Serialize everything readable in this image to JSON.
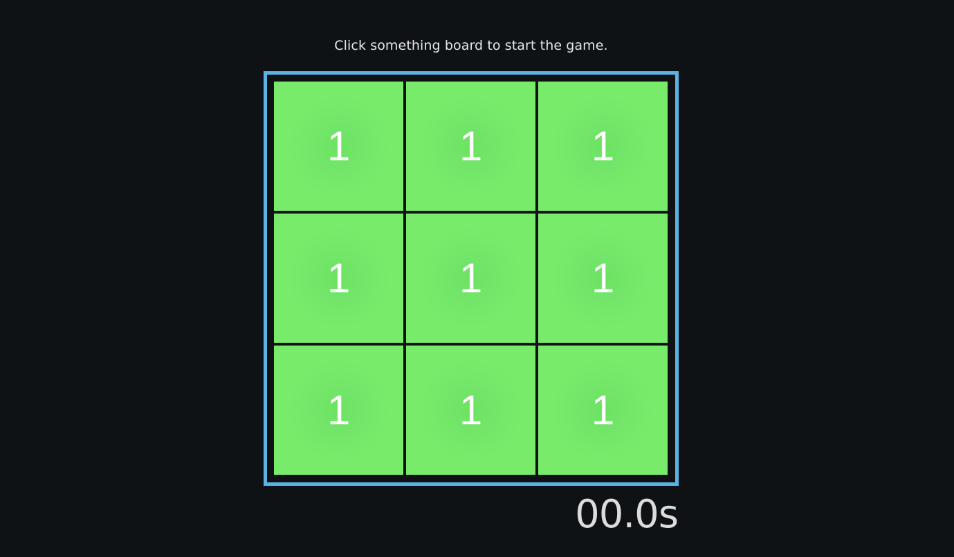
{
  "instruction": "Click something board to start the game.",
  "board": {
    "cells": [
      "1",
      "1",
      "1",
      "1",
      "1",
      "1",
      "1",
      "1",
      "1"
    ]
  },
  "timer": "00.0s",
  "colors": {
    "background": "#0f1215",
    "board_border": "#5cb3e3",
    "cell_fill": "#78eb6b",
    "cell_text": "#ffffff"
  }
}
